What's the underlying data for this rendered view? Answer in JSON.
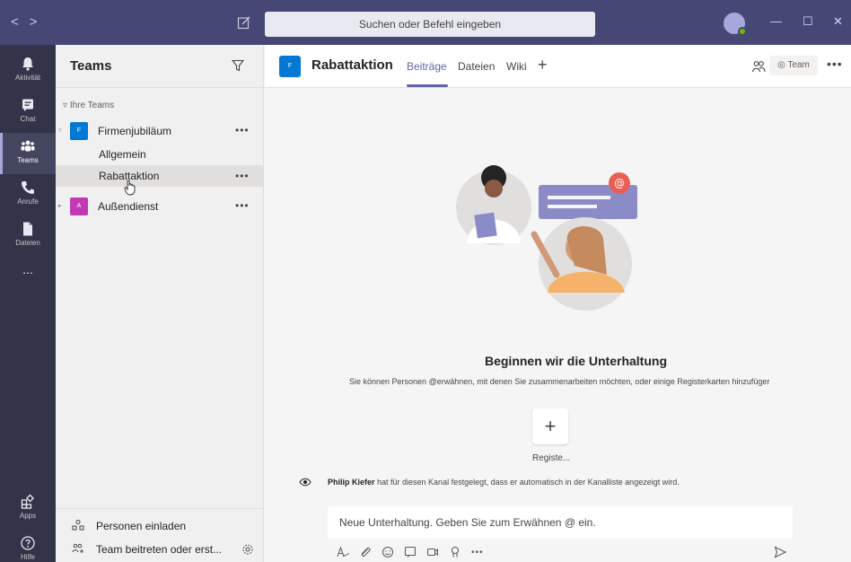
{
  "titlebar": {
    "back_glyph": "<",
    "forward_glyph": ">",
    "search_placeholder": "Suchen oder Befehl eingeben",
    "minimize_glyph": "—",
    "maximize_glyph": "☐",
    "close_glyph": "✕"
  },
  "appbar": {
    "items": [
      {
        "label": "Aktivität",
        "icon": "bell-icon"
      },
      {
        "label": "Chat",
        "icon": "chat-icon"
      },
      {
        "label": "Teams",
        "icon": "teams-icon",
        "active": true
      },
      {
        "label": "Anrufe",
        "icon": "phone-icon"
      },
      {
        "label": "Dateien",
        "icon": "file-icon"
      },
      {
        "label": "...",
        "icon": "more-icon"
      }
    ],
    "apps_label": "Apps",
    "help_label": "Hilfe"
  },
  "teams_panel": {
    "title": "Teams",
    "section_label": "Ihre Teams",
    "teams": [
      {
        "name": "Firmenjubiläum",
        "tile": "F",
        "color": "#0078d4",
        "more": "•••",
        "channels": [
          "Allgemein",
          "Rabattaktion"
        ]
      },
      {
        "name": "Außendienst",
        "tile": "A",
        "color": "#c239b3",
        "more": "•••"
      }
    ],
    "selected_channel_more": "•••",
    "footer": {
      "invite_label": "Personen einladen",
      "join_label": "Team beitreten oder erst..."
    }
  },
  "channel_header": {
    "tile": "F",
    "title": "Rabattaktion",
    "tabs": [
      "Beiträge",
      "Dateien",
      "Wiki"
    ],
    "active_tab": "Beiträge",
    "add_tab_glyph": "+",
    "team_button_label": "Team",
    "more": "•••"
  },
  "main": {
    "empty_title": "Beginnen wir die Unterhaltung",
    "empty_subtitle": "Sie können Personen @erwähnen, mit denen Sie zusammenarbeiten möchten, oder einige Registerkarten hinzufüger",
    "add_tile_glyph": "+",
    "add_tile_label": "Registe...",
    "notice_user": "Philip Kiefer",
    "notice_text": " hat für diesen Kanal festgelegt, dass er automatisch in der Kanalliste angezeigt wird.",
    "compose_placeholder": "Neue Unterhaltung. Geben Sie zum Erwähnen @ ein.",
    "format_more": "•••"
  },
  "colors": {
    "titlebar": "#464775",
    "appbar": "#33344a",
    "accent": "#6264a7",
    "panel": "#f0f0f0"
  }
}
